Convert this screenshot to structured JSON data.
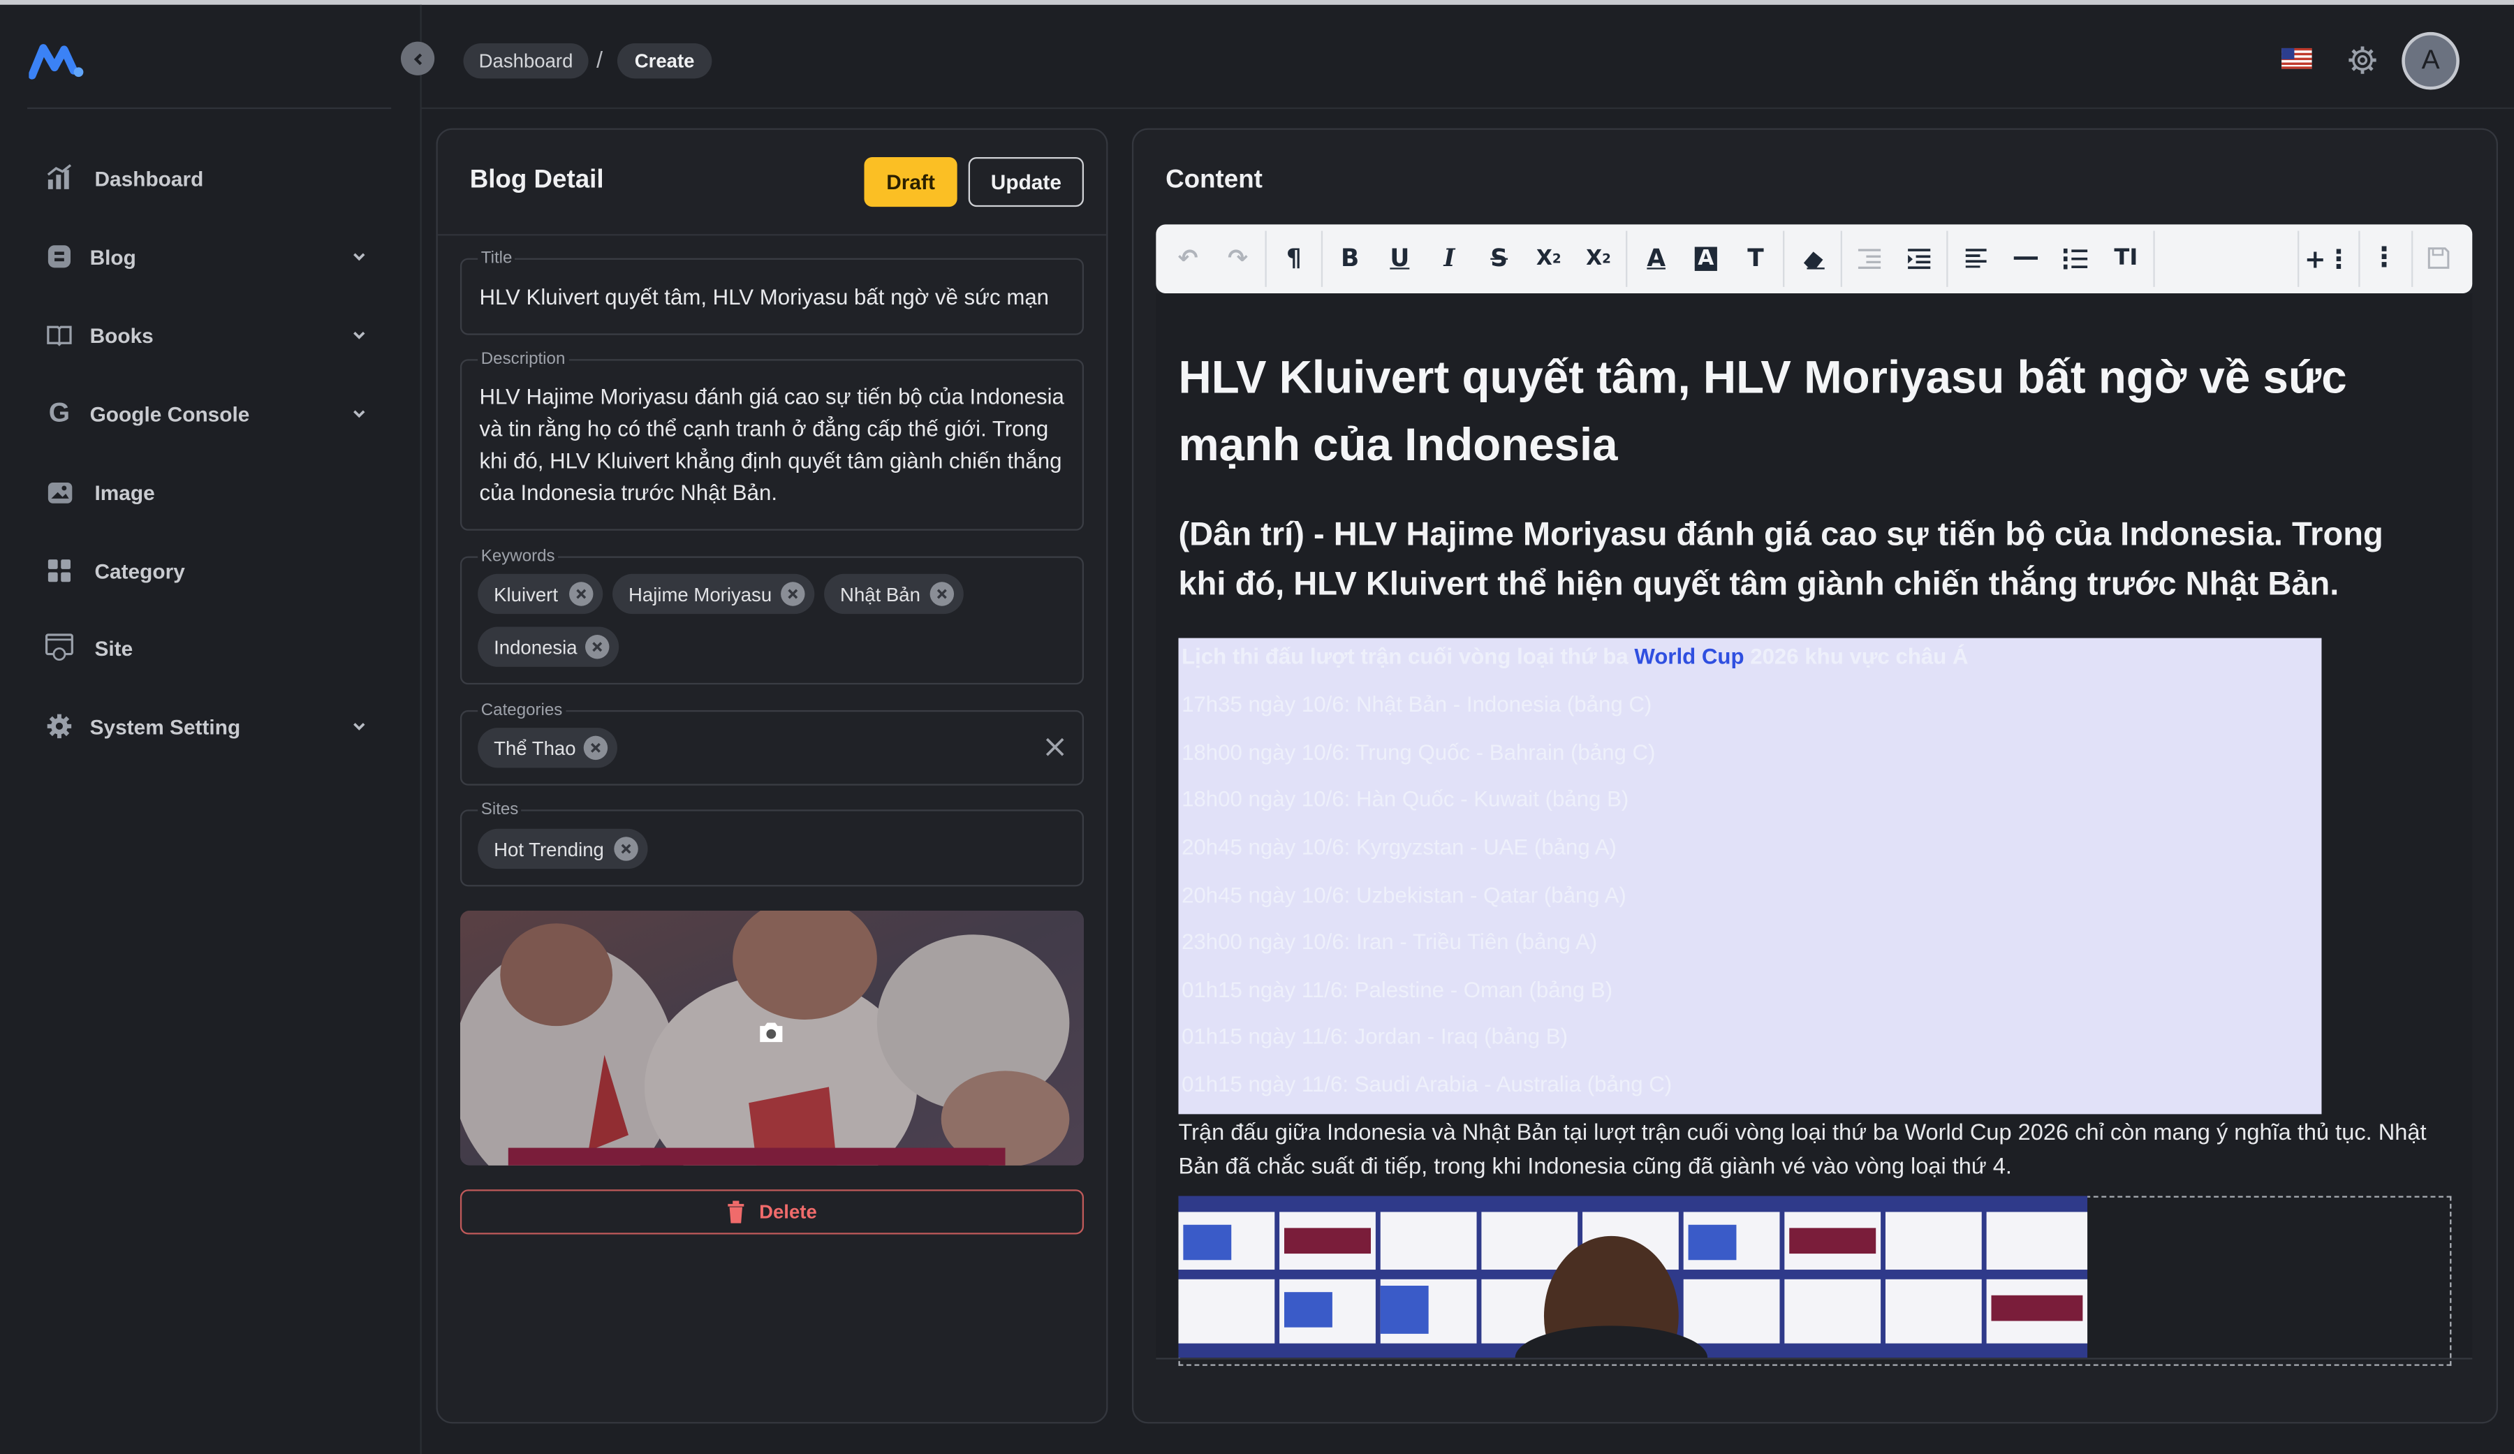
{
  "sidebar": {
    "logo_icon": "m-logo",
    "items": [
      {
        "label": "Dashboard",
        "icon": "chart-icon",
        "has_chevron": false
      },
      {
        "label": "Blog",
        "icon": "blog-icon",
        "has_chevron": true
      },
      {
        "label": "Books",
        "icon": "book-icon",
        "has_chevron": true
      },
      {
        "label": "Google Console",
        "icon": "google-icon",
        "has_chevron": true
      },
      {
        "label": "Image",
        "icon": "image-icon",
        "has_chevron": false
      },
      {
        "label": "Category",
        "icon": "grid-icon",
        "has_chevron": false
      },
      {
        "label": "Site",
        "icon": "site-icon",
        "has_chevron": false
      },
      {
        "label": "System Setting",
        "icon": "gear-icon",
        "has_chevron": true
      }
    ]
  },
  "header": {
    "breadcrumb": [
      "Dashboard",
      "Create"
    ],
    "separator": "/",
    "avatar_letter": "A",
    "flag_icon": "us-flag-icon",
    "settings_icon": "gear-icon"
  },
  "detail": {
    "title": "Blog Detail",
    "draft_label": "Draft",
    "update_label": "Update",
    "title_label": "Title",
    "title_value": "HLV Kluivert quyết tâm, HLV Moriyasu bất ngờ về sức mạn",
    "description_label": "Description",
    "description_value": "HLV Hajime Moriyasu đánh giá cao sự tiến bộ của Indonesia và tin rằng họ có thể cạnh tranh ở đẳng cấp thế giới. Trong khi đó, HLV Kluivert khẳng định quyết tâm giành chiến thắng của Indonesia trước Nhật Bản.",
    "keywords_label": "Keywords",
    "keywords": [
      "Kluivert",
      "Hajime Moriyasu",
      "Nhật Bản",
      "Indonesia"
    ],
    "categories_label": "Categories",
    "categories": [
      "Thể Thao"
    ],
    "sites_label": "Sites",
    "sites": [
      "Hot Trending"
    ],
    "delete_label": "Delete"
  },
  "content": {
    "title": "Content",
    "h1": "HLV Kluivert quyết tâm, HLV Moriyasu bất ngờ về sức mạnh của Indonesia",
    "h2": "(Dân trí) - HLV Hajime Moriyasu đánh giá cao sự tiến bộ của Indonesia. Trong khi đó, HLV Kluivert thể hiện quyết tâm giành chiến thắng trước Nhật Bản.",
    "schedule_prefix": "Lịch thi đấu lượt trận cuối vòng loại thứ ba ",
    "schedule_link": "World Cup",
    "schedule_suffix": " 2026 khu vực châu Á",
    "schedule": [
      "17h35 ngày 10/6: Nhật Bản - Indonesia (bảng C)",
      "18h00 ngày 10/6: Trung Quốc - Bahrain (bảng C)",
      "18h00 ngày 10/6: Hàn Quốc - Kuwait (bảng B)",
      "20h45 ngày 10/6: Kyrgyzstan - UAE (bảng A)",
      "20h45 ngày 10/6: Uzbekistan - Qatar (bảng A)",
      "23h00 ngày 10/6: Iran - Triều Tiên (bảng A)",
      "01h15 ngày 11/6: Palestine - Oman (bảng B)",
      "01h15 ngày 11/6: Jordan - Iraq (bảng B)",
      "01h15 ngày 11/6: Saudi Arabia - Australia (bảng C)"
    ],
    "paragraph": "Trận đấu giữa Indonesia và Nhật Bản tại lượt trận cuối vòng loại thứ ba World Cup 2026 chỉ còn mang ý nghĩa thủ tục. Nhật Bản đã chắc suất đi tiếp, trong khi Indonesia cũng đã giành vé vào vòng loại thứ 4.",
    "toolbar": [
      "undo-icon",
      "redo-icon",
      "paragraph-icon",
      "bold-icon",
      "underline-icon",
      "italic-icon",
      "strikethrough-icon",
      "subscript-icon",
      "superscript-icon",
      "font-color-icon",
      "highlight-color-icon",
      "text-style-icon",
      "eraser-icon",
      "outdent-icon",
      "indent-icon",
      "align-icon",
      "horizontal-rule-icon",
      "list-icon",
      "font-size-icon",
      "insert-icon",
      "more-icon",
      "save-icon"
    ]
  },
  "colors": {
    "accent": "#fbbf24",
    "danger": "#f06b6b",
    "link": "#2f4fe0",
    "logo": "#3b82f6"
  }
}
